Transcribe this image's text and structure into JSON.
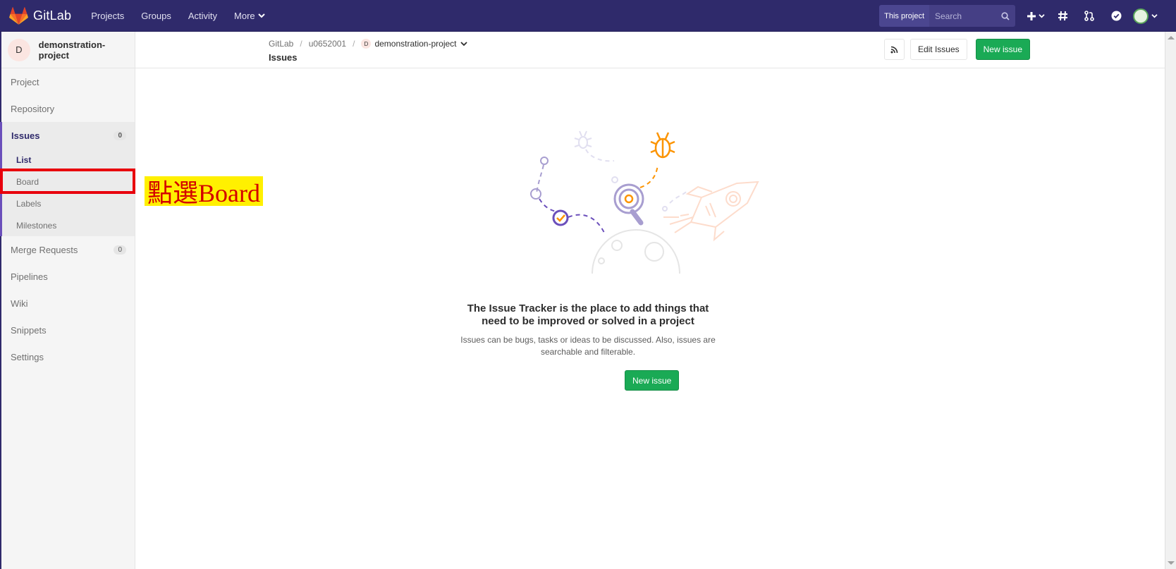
{
  "topbar": {
    "logo_text": "GitLab",
    "nav": [
      {
        "label": "Projects"
      },
      {
        "label": "Groups"
      },
      {
        "label": "Activity"
      },
      {
        "label": "More"
      }
    ],
    "search_scope": "This project",
    "search_placeholder": "Search"
  },
  "sidebar": {
    "project_avatar": "D",
    "project_name": "demonstration-project",
    "items": {
      "project": "Project",
      "repository": "Repository",
      "issues": "Issues",
      "issues_count": "0",
      "merge_requests": "Merge Requests",
      "merge_requests_count": "0",
      "pipelines": "Pipelines",
      "wiki": "Wiki",
      "snippets": "Snippets",
      "settings": "Settings"
    },
    "issues_sub": {
      "list": "List",
      "board": "Board",
      "labels": "Labels",
      "milestones": "Milestones"
    }
  },
  "annotation": "點選Board",
  "header": {
    "breadcrumb": [
      "GitLab",
      "u0652001",
      "demonstration-project"
    ],
    "breadcrumb_avatar": "D",
    "title": "Issues",
    "edit_label": "Edit Issues",
    "new_issue_label": "New issue"
  },
  "empty_state": {
    "title_line1": "The Issue Tracker is the place to add things that",
    "title_line2": "need to be improved or solved in a project",
    "desc_line1": "Issues can be bugs, tasks or ideas to be discussed. Also, issues are",
    "desc_line2": "searchable and filterable.",
    "button_label": "New issue"
  },
  "colors": {
    "navbar": "#2f2a6b",
    "success": "#1aaa55",
    "annotation_bg": "#fff000",
    "annotation_text": "#d30000",
    "highlight_border": "#e8000d"
  }
}
